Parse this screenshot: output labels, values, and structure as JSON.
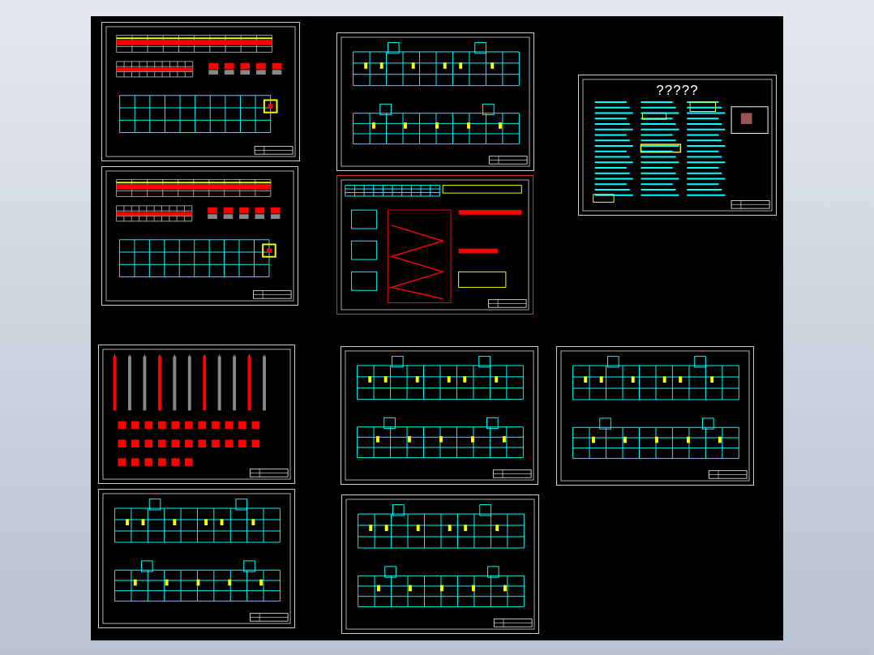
{
  "canvas": {
    "sheets": [
      {
        "kind": "beam",
        "selected": false
      },
      {
        "kind": "beam",
        "selected": false
      },
      {
        "kind": "plan",
        "selected": false
      },
      {
        "kind": "stair",
        "selected": true
      },
      {
        "kind": "notes",
        "selected": false,
        "title": "?????"
      },
      {
        "kind": "column",
        "selected": false
      },
      {
        "kind": "plan",
        "selected": false
      },
      {
        "kind": "plan",
        "selected": false
      },
      {
        "kind": "plan",
        "selected": false
      },
      {
        "kind": "plan",
        "selected": false
      }
    ]
  }
}
